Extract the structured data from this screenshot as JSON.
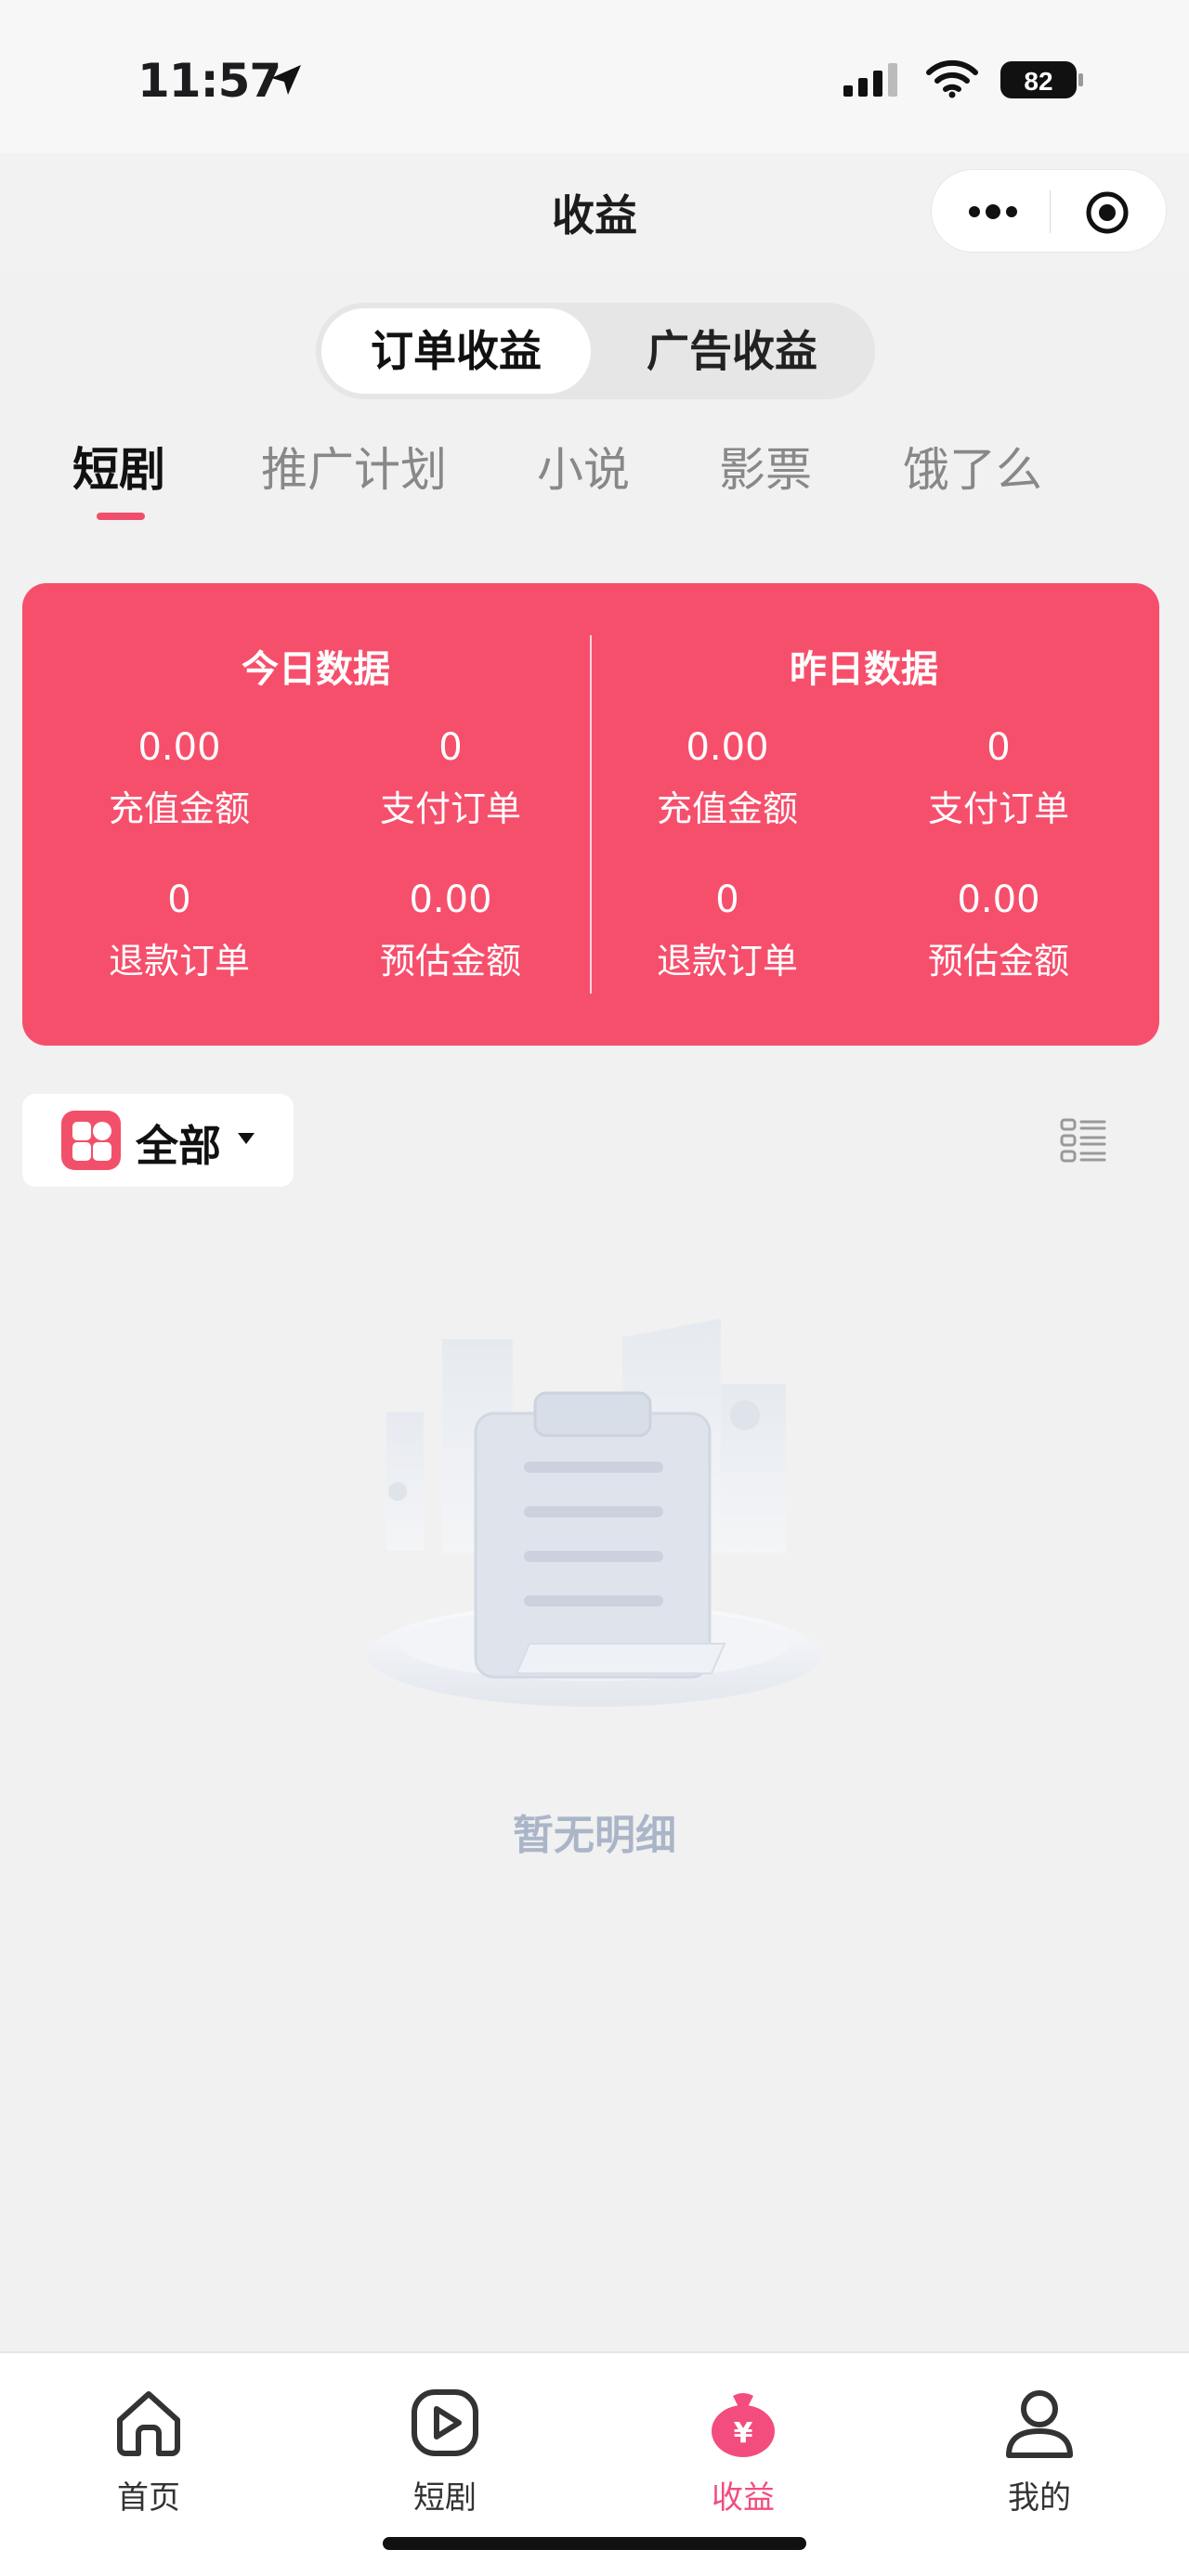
{
  "status_bar": {
    "time": "11:57",
    "battery": "82"
  },
  "nav": {
    "title": "收益"
  },
  "segment": {
    "options": [
      "订单收益",
      "广告收益"
    ],
    "selected": "订单收益"
  },
  "categories": {
    "tabs": [
      "短剧",
      "推广计划",
      "小说",
      "影票",
      "饿了么"
    ],
    "selected": "短剧"
  },
  "stats": {
    "today": {
      "title": "今日数据",
      "recharge_amount": {
        "value": "0.00",
        "label": "充值金额"
      },
      "paid_orders": {
        "value": "0",
        "label": "支付订单"
      },
      "refund_orders": {
        "value": "0",
        "label": "退款订单"
      },
      "estimated_amount": {
        "value": "0.00",
        "label": "预估金额"
      }
    },
    "yesterday": {
      "title": "昨日数据",
      "recharge_amount": {
        "value": "0.00",
        "label": "充值金额"
      },
      "paid_orders": {
        "value": "0",
        "label": "支付订单"
      },
      "refund_orders": {
        "value": "0",
        "label": "退款订单"
      },
      "estimated_amount": {
        "value": "0.00",
        "label": "预估金额"
      }
    }
  },
  "filter": {
    "label": "全部",
    "icon": "grid-icon"
  },
  "empty_state": {
    "text": "暂无明细"
  },
  "tabbar": {
    "items": [
      {
        "label": "首页",
        "icon": "home-icon"
      },
      {
        "label": "短剧",
        "icon": "play-icon"
      },
      {
        "label": "收益",
        "icon": "money-bag-icon"
      },
      {
        "label": "我的",
        "icon": "user-icon"
      }
    ],
    "selected": "收益"
  },
  "colors": {
    "accent": "#f64f6c",
    "tab_active": "#f24d7d",
    "empty_text": "#aab6c8"
  }
}
